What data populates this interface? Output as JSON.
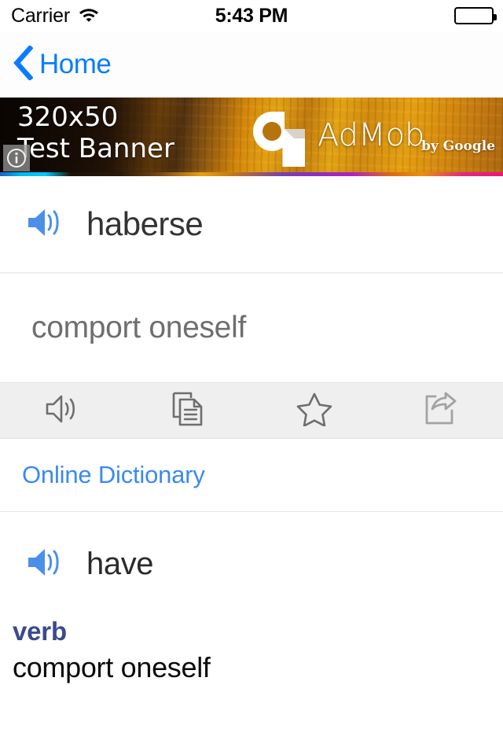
{
  "status_bar": {
    "carrier": "Carrier",
    "wifi_icon": "wifi-icon",
    "time": "5:43 PM",
    "battery_icon": "battery-full-icon"
  },
  "nav_bar": {
    "back_icon": "chevron-left-icon",
    "back_label": "Home"
  },
  "ad_banner": {
    "line1": "320x50",
    "line2": "Test Banner",
    "brand": "AdMob",
    "brand_sub": "by Google",
    "info_icon": "info-icon",
    "logo_icon": "admob-logo-icon"
  },
  "entry": {
    "speaker_icon": "speaker-icon",
    "headword": "haberse",
    "meaning": "comport oneself"
  },
  "toolbar": {
    "items": [
      {
        "icon": "speaker-outline-icon",
        "name": "speak-button"
      },
      {
        "icon": "copy-icon",
        "name": "copy-button"
      },
      {
        "icon": "star-outline-icon",
        "name": "favorite-button"
      },
      {
        "icon": "share-icon",
        "name": "share-button"
      }
    ]
  },
  "online_dictionary": {
    "label": "Online Dictionary"
  },
  "definition": {
    "speaker_icon": "speaker-icon",
    "word": "have",
    "part_of_speech": "verb",
    "text": "comport oneself"
  },
  "colors": {
    "ios_blue": "#0a7cff",
    "link_blue": "#3b8aee",
    "speaker_blue": "#4a90ea",
    "pos_navy": "#3a4a8c",
    "toolbar_bg": "#efefef",
    "icon_gray": "#6e6e6e"
  }
}
